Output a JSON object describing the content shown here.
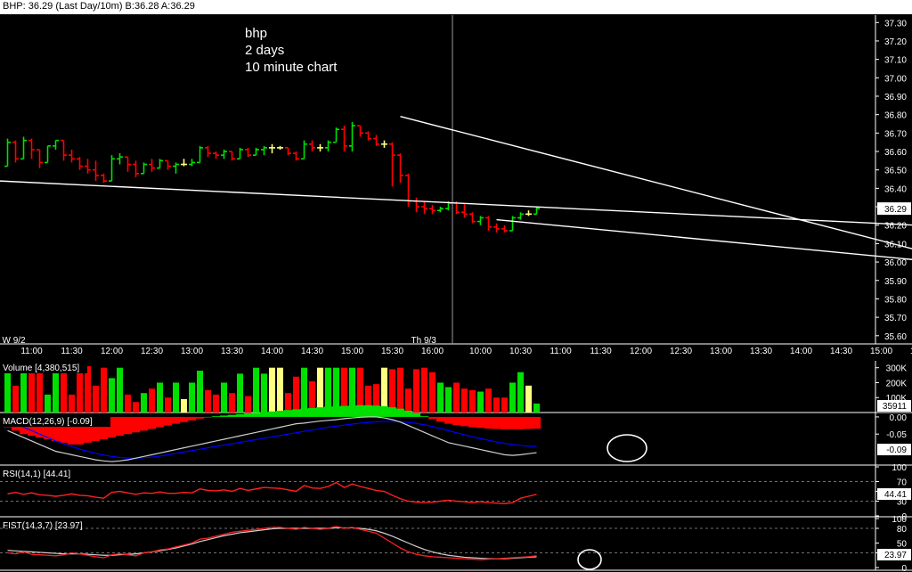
{
  "window_title": "BHP: 36.29 (Last Day/10m)  B:36.28 A:36.29",
  "colors": {
    "up": "#00e000",
    "down": "#ff0000",
    "neutral": "#ffff80",
    "grid": "#3a3a3a",
    "axis": "#ffffff",
    "trendline": "#ffffff",
    "macd_line": "#d0d0d0",
    "signal_line": "#0000ff",
    "rsi_line": "#ff2020",
    "fist_k": "#ff2020",
    "fist_d": "#d0d0d0"
  },
  "chart_data": [
    {
      "type": "ohlc",
      "annotation": [
        "bhp",
        "2 days",
        "10 minute chart"
      ],
      "y_ticks": [
        "37.30",
        "37.20",
        "37.10",
        "37.00",
        "36.90",
        "36.80",
        "36.70",
        "36.60",
        "36.50",
        "36.40",
        "36.30",
        "36.20",
        "36.10",
        "36.00",
        "35.90",
        "35.80",
        "35.70",
        "35.60"
      ],
      "ylim": [
        35.57,
        37.34
      ],
      "last_price_label": "36.29",
      "last_price": 36.29,
      "x_day_labels": [
        {
          "text": "W  9/2",
          "bar": 0
        },
        {
          "text": "Th  9/3",
          "bar": 51
        }
      ],
      "x_time_labels": [
        {
          "text": "11:00",
          "bar": 3
        },
        {
          "text": "11:30",
          "bar": 8
        },
        {
          "text": "12:00",
          "bar": 13
        },
        {
          "text": "12:30",
          "bar": 18
        },
        {
          "text": "13:00",
          "bar": 23
        },
        {
          "text": "13:30",
          "bar": 28
        },
        {
          "text": "14:00",
          "bar": 33
        },
        {
          "text": "14:30",
          "bar": 38
        },
        {
          "text": "15:00",
          "bar": 43
        },
        {
          "text": "15:30",
          "bar": 48
        },
        {
          "text": "16:00",
          "bar": 53
        },
        {
          "text": "10:00",
          "bar": 59
        },
        {
          "text": "10:30",
          "bar": 64
        },
        {
          "text": "11:00",
          "bar": 69
        },
        {
          "text": "11:30",
          "bar": 74
        },
        {
          "text": "12:00",
          "bar": 79
        },
        {
          "text": "12:30",
          "bar": 84
        },
        {
          "text": "13:00",
          "bar": 89
        },
        {
          "text": "13:30",
          "bar": 94
        },
        {
          "text": "14:00",
          "bar": 99
        },
        {
          "text": "14:30",
          "bar": 104
        },
        {
          "text": "15:00",
          "bar": 109
        },
        {
          "text": "15:30",
          "bar": 114
        }
      ],
      "bars": [
        {
          "o": 36.52,
          "h": 36.67,
          "l": 36.52,
          "c": 36.65
        },
        {
          "o": 36.65,
          "h": 36.66,
          "l": 36.54,
          "c": 36.56
        },
        {
          "o": 36.56,
          "h": 36.68,
          "l": 36.56,
          "c": 36.66
        },
        {
          "o": 36.66,
          "h": 36.67,
          "l": 36.56,
          "c": 36.61
        },
        {
          "o": 36.61,
          "h": 36.61,
          "l": 36.51,
          "c": 36.54
        },
        {
          "o": 36.54,
          "h": 36.63,
          "l": 36.54,
          "c": 36.63
        },
        {
          "o": 36.63,
          "h": 36.66,
          "l": 36.61,
          "c": 36.66
        },
        {
          "o": 36.66,
          "h": 36.66,
          "l": 36.55,
          "c": 36.58
        },
        {
          "o": 36.58,
          "h": 36.61,
          "l": 36.54,
          "c": 36.56
        },
        {
          "o": 36.56,
          "h": 36.57,
          "l": 36.5,
          "c": 36.52
        },
        {
          "o": 36.52,
          "h": 36.56,
          "l": 36.48,
          "c": 36.5
        },
        {
          "o": 36.5,
          "h": 36.55,
          "l": 36.44,
          "c": 36.47
        },
        {
          "o": 36.47,
          "h": 36.48,
          "l": 36.43,
          "c": 36.44
        },
        {
          "o": 36.44,
          "h": 36.58,
          "l": 36.44,
          "c": 36.56
        },
        {
          "o": 36.56,
          "h": 36.59,
          "l": 36.53,
          "c": 36.57
        },
        {
          "o": 36.57,
          "h": 36.57,
          "l": 36.49,
          "c": 36.53
        },
        {
          "o": 36.53,
          "h": 36.55,
          "l": 36.46,
          "c": 36.48
        },
        {
          "o": 36.48,
          "h": 36.54,
          "l": 36.48,
          "c": 36.53
        },
        {
          "o": 36.53,
          "h": 36.56,
          "l": 36.49,
          "c": 36.51
        },
        {
          "o": 36.51,
          "h": 36.56,
          "l": 36.51,
          "c": 36.55
        },
        {
          "o": 36.55,
          "h": 36.55,
          "l": 36.5,
          "c": 36.52
        },
        {
          "o": 36.52,
          "h": 36.54,
          "l": 36.48,
          "c": 36.53
        },
        {
          "o": 36.53,
          "h": 36.56,
          "l": 36.52,
          "c": 36.53
        },
        {
          "o": 36.53,
          "h": 36.56,
          "l": 36.52,
          "c": 36.54
        },
        {
          "o": 36.54,
          "h": 36.63,
          "l": 36.54,
          "c": 36.62
        },
        {
          "o": 36.62,
          "h": 36.63,
          "l": 36.57,
          "c": 36.59
        },
        {
          "o": 36.59,
          "h": 36.6,
          "l": 36.56,
          "c": 36.58
        },
        {
          "o": 36.58,
          "h": 36.61,
          "l": 36.56,
          "c": 36.6
        },
        {
          "o": 36.6,
          "h": 36.6,
          "l": 36.55,
          "c": 36.56
        },
        {
          "o": 36.56,
          "h": 36.62,
          "l": 36.56,
          "c": 36.61
        },
        {
          "o": 36.61,
          "h": 36.62,
          "l": 36.57,
          "c": 36.58
        },
        {
          "o": 36.58,
          "h": 36.62,
          "l": 36.58,
          "c": 36.61
        },
        {
          "o": 36.61,
          "h": 36.63,
          "l": 36.58,
          "c": 36.62
        },
        {
          "o": 36.62,
          "h": 36.64,
          "l": 36.59,
          "c": 36.62
        },
        {
          "o": 36.62,
          "h": 36.63,
          "l": 36.61,
          "c": 36.62
        },
        {
          "o": 36.62,
          "h": 36.62,
          "l": 36.58,
          "c": 36.59
        },
        {
          "o": 36.59,
          "h": 36.6,
          "l": 36.55,
          "c": 36.56
        },
        {
          "o": 36.56,
          "h": 36.66,
          "l": 36.56,
          "c": 36.64
        },
        {
          "o": 36.64,
          "h": 36.66,
          "l": 36.6,
          "c": 36.62
        },
        {
          "o": 36.62,
          "h": 36.64,
          "l": 36.6,
          "c": 36.62
        },
        {
          "o": 36.62,
          "h": 36.66,
          "l": 36.6,
          "c": 36.65
        },
        {
          "o": 36.65,
          "h": 36.73,
          "l": 36.65,
          "c": 36.72
        },
        {
          "o": 36.72,
          "h": 36.74,
          "l": 36.6,
          "c": 36.63
        },
        {
          "o": 36.63,
          "h": 36.76,
          "l": 36.6,
          "c": 36.74
        },
        {
          "o": 36.74,
          "h": 36.74,
          "l": 36.68,
          "c": 36.7
        },
        {
          "o": 36.7,
          "h": 36.71,
          "l": 36.66,
          "c": 36.67
        },
        {
          "o": 36.67,
          "h": 36.69,
          "l": 36.63,
          "c": 36.64
        },
        {
          "o": 36.64,
          "h": 36.66,
          "l": 36.62,
          "c": 36.64
        },
        {
          "o": 36.64,
          "h": 36.65,
          "l": 36.41,
          "c": 36.58
        },
        {
          "o": 36.58,
          "h": 36.59,
          "l": 36.43,
          "c": 36.47
        },
        {
          "o": 36.47,
          "h": 36.48,
          "l": 36.3,
          "c": 36.33
        },
        {
          "o": 36.33,
          "h": 36.35,
          "l": 36.27,
          "c": 36.3
        },
        {
          "o": 36.3,
          "h": 36.33,
          "l": 36.26,
          "c": 36.29
        },
        {
          "o": 36.29,
          "h": 36.31,
          "l": 36.26,
          "c": 36.28
        },
        {
          "o": 36.28,
          "h": 36.3,
          "l": 36.27,
          "c": 36.29
        },
        {
          "o": 36.29,
          "h": 36.33,
          "l": 36.28,
          "c": 36.32
        },
        {
          "o": 36.32,
          "h": 36.33,
          "l": 36.26,
          "c": 36.27
        },
        {
          "o": 36.27,
          "h": 36.32,
          "l": 36.24,
          "c": 36.26
        },
        {
          "o": 36.26,
          "h": 36.27,
          "l": 36.21,
          "c": 36.22
        },
        {
          "o": 36.22,
          "h": 36.25,
          "l": 36.2,
          "c": 36.24
        },
        {
          "o": 36.24,
          "h": 36.25,
          "l": 36.17,
          "c": 36.19
        },
        {
          "o": 36.19,
          "h": 36.21,
          "l": 36.16,
          "c": 36.18
        },
        {
          "o": 36.18,
          "h": 36.2,
          "l": 36.16,
          "c": 36.17
        },
        {
          "o": 36.17,
          "h": 36.25,
          "l": 36.17,
          "c": 36.24
        },
        {
          "o": 36.24,
          "h": 36.27,
          "l": 36.23,
          "c": 36.26
        },
        {
          "o": 36.26,
          "h": 36.28,
          "l": 36.25,
          "c": 36.26
        },
        {
          "o": 36.26,
          "h": 36.3,
          "l": 36.26,
          "c": 36.29
        }
      ],
      "trendlines": [
        {
          "bar1": -1,
          "p1": 36.44,
          "bar2": 118,
          "p2": 36.19
        },
        {
          "bar1": 49,
          "p1": 36.79,
          "bar2": 117.5,
          "p2": 36.02
        },
        {
          "bar1": 61,
          "p1": 36.23,
          "bar2": 118.5,
          "p2": 35.99
        }
      ],
      "crosshair_bar": 55.5
    },
    {
      "type": "bar",
      "name": "Volume",
      "legend": "Volume",
      "legend_value": "[4,380,515]",
      "y_ticks": [
        "300K",
        "200K",
        "100K"
      ],
      "ylim": [
        0,
        340000
      ],
      "last_label": "35911",
      "values": [
        300000,
        180000,
        300000,
        310000,
        300000,
        120000,
        290000,
        310000,
        120000,
        290000,
        310000,
        180000,
        300000,
        230000,
        300000,
        120000,
        70000,
        130000,
        160000,
        200000,
        100000,
        200000,
        90000,
        200000,
        280000,
        150000,
        120000,
        200000,
        130000,
        260000,
        110000,
        300000,
        260000,
        300000,
        300000,
        130000,
        240000,
        300000,
        210000,
        300000,
        300000,
        300000,
        300000,
        300000,
        300000,
        180000,
        190000,
        300000,
        290000,
        300000,
        160000,
        290000,
        300000,
        270000,
        200000,
        170000,
        200000,
        160000,
        150000,
        140000,
        160000,
        100000,
        100000,
        200000,
        270000,
        180000,
        60000
      ]
    },
    {
      "type": "area+line",
      "name": "MACD",
      "legend": "MACD(12,26,9)",
      "legend_value": "[-0.09]",
      "y_ticks": [
        "0.00",
        "-0.05"
      ],
      "ylim": [
        -0.135,
        0.005
      ],
      "last_label": "-0.09",
      "histogram": [
        -0.03,
        -0.04,
        -0.05,
        -0.055,
        -0.06,
        -0.065,
        -0.07,
        -0.075,
        -0.08,
        -0.08,
        -0.075,
        -0.07,
        -0.065,
        -0.06,
        -0.055,
        -0.05,
        -0.045,
        -0.04,
        -0.035,
        -0.03,
        -0.025,
        -0.02,
        -0.015,
        -0.01,
        -0.005,
        0.0,
        0.002,
        0.004,
        0.006,
        0.008,
        0.01,
        0.012,
        0.014,
        0.016,
        0.018,
        0.02,
        0.022,
        0.024,
        0.026,
        0.028,
        0.03,
        0.031,
        0.032,
        0.033,
        0.034,
        0.034,
        0.033,
        0.031,
        0.028,
        0.024,
        0.018,
        0.01,
        0.002,
        -0.006,
        -0.014,
        -0.02,
        -0.024,
        -0.027,
        -0.03,
        -0.032,
        -0.034,
        -0.035,
        -0.036,
        -0.036,
        -0.036,
        -0.035,
        -0.034
      ],
      "macd": [
        -0.04,
        -0.05,
        -0.06,
        -0.07,
        -0.08,
        -0.09,
        -0.1,
        -0.105,
        -0.11,
        -0.115,
        -0.12,
        -0.125,
        -0.128,
        -0.13,
        -0.128,
        -0.125,
        -0.12,
        -0.115,
        -0.11,
        -0.105,
        -0.1,
        -0.095,
        -0.09,
        -0.085,
        -0.08,
        -0.075,
        -0.07,
        -0.065,
        -0.06,
        -0.055,
        -0.05,
        -0.045,
        -0.04,
        -0.035,
        -0.03,
        -0.025,
        -0.02,
        -0.018,
        -0.015,
        -0.012,
        -0.01,
        -0.008,
        -0.005,
        -0.003,
        -0.001,
        0.0,
        0.0,
        -0.003,
        -0.008,
        -0.015,
        -0.025,
        -0.035,
        -0.045,
        -0.055,
        -0.065,
        -0.075,
        -0.08,
        -0.085,
        -0.09,
        -0.095,
        -0.1,
        -0.105,
        -0.11,
        -0.112,
        -0.11,
        -0.107,
        -0.104
      ],
      "signal": [
        -0.01,
        -0.02,
        -0.03,
        -0.04,
        -0.05,
        -0.06,
        -0.07,
        -0.078,
        -0.086,
        -0.094,
        -0.1,
        -0.106,
        -0.111,
        -0.115,
        -0.118,
        -0.12,
        -0.12,
        -0.119,
        -0.117,
        -0.114,
        -0.11,
        -0.106,
        -0.102,
        -0.098,
        -0.094,
        -0.09,
        -0.086,
        -0.082,
        -0.078,
        -0.074,
        -0.07,
        -0.066,
        -0.062,
        -0.058,
        -0.054,
        -0.05,
        -0.046,
        -0.042,
        -0.038,
        -0.034,
        -0.03,
        -0.027,
        -0.024,
        -0.021,
        -0.018,
        -0.016,
        -0.014,
        -0.013,
        -0.013,
        -0.014,
        -0.016,
        -0.019,
        -0.023,
        -0.028,
        -0.034,
        -0.04,
        -0.046,
        -0.052,
        -0.058,
        -0.063,
        -0.068,
        -0.073,
        -0.077,
        -0.08,
        -0.083,
        -0.085,
        -0.086
      ]
    },
    {
      "type": "line",
      "name": "RSI",
      "legend": "RSI(14,1)",
      "legend_value": "[44.41]",
      "y_ticks": [
        "100",
        "70",
        "50",
        "30",
        "0"
      ],
      "ylim": [
        0,
        100
      ],
      "last_label": "44.41",
      "values": [
        45,
        48,
        44,
        47,
        43,
        42,
        40,
        42,
        45,
        42,
        41,
        38,
        36,
        48,
        50,
        47,
        44,
        47,
        46,
        49,
        46,
        46,
        48,
        47,
        55,
        52,
        51,
        53,
        50,
        56,
        52,
        55,
        58,
        57,
        56,
        53,
        50,
        62,
        57,
        56,
        60,
        68,
        58,
        65,
        60,
        56,
        52,
        50,
        42,
        35,
        30,
        28,
        27,
        28,
        30,
        32,
        30,
        29,
        27,
        29,
        27,
        26,
        25,
        27,
        36,
        40,
        44
      ]
    },
    {
      "type": "line",
      "name": "FIST",
      "legend": "FIST(14,3,7)",
      "legend_value": "[23.97]",
      "y_ticks": [
        "100",
        "80",
        "50",
        "30",
        "0"
      ],
      "ylim": [
        0,
        100
      ],
      "last_label": "23.97",
      "k": [
        30,
        28,
        32,
        27,
        26,
        25,
        24,
        26,
        30,
        28,
        25,
        22,
        20,
        26,
        28,
        26,
        24,
        30,
        32,
        36,
        38,
        42,
        46,
        50,
        58,
        60,
        64,
        68,
        72,
        74,
        76,
        78,
        80,
        82,
        82,
        80,
        78,
        82,
        80,
        78,
        80,
        84,
        80,
        82,
        78,
        74,
        70,
        60,
        50,
        40,
        32,
        27,
        24,
        22,
        21,
        20,
        19,
        18,
        17,
        16,
        17,
        18,
        19,
        20,
        21,
        22,
        24
      ],
      "d": [
        35,
        34,
        33,
        32,
        31,
        30,
        29,
        28,
        28,
        28,
        27,
        26,
        25,
        25,
        26,
        27,
        28,
        30,
        32,
        34,
        37,
        40,
        44,
        48,
        53,
        57,
        61,
        65,
        68,
        71,
        73,
        75,
        77,
        79,
        80,
        80,
        80,
        80,
        80,
        80,
        80,
        81,
        81,
        81,
        80,
        78,
        75,
        70,
        64,
        57,
        50,
        43,
        37,
        32,
        28,
        25,
        23,
        21,
        20,
        19,
        18,
        18,
        18,
        19,
        20,
        21,
        22
      ]
    }
  ]
}
